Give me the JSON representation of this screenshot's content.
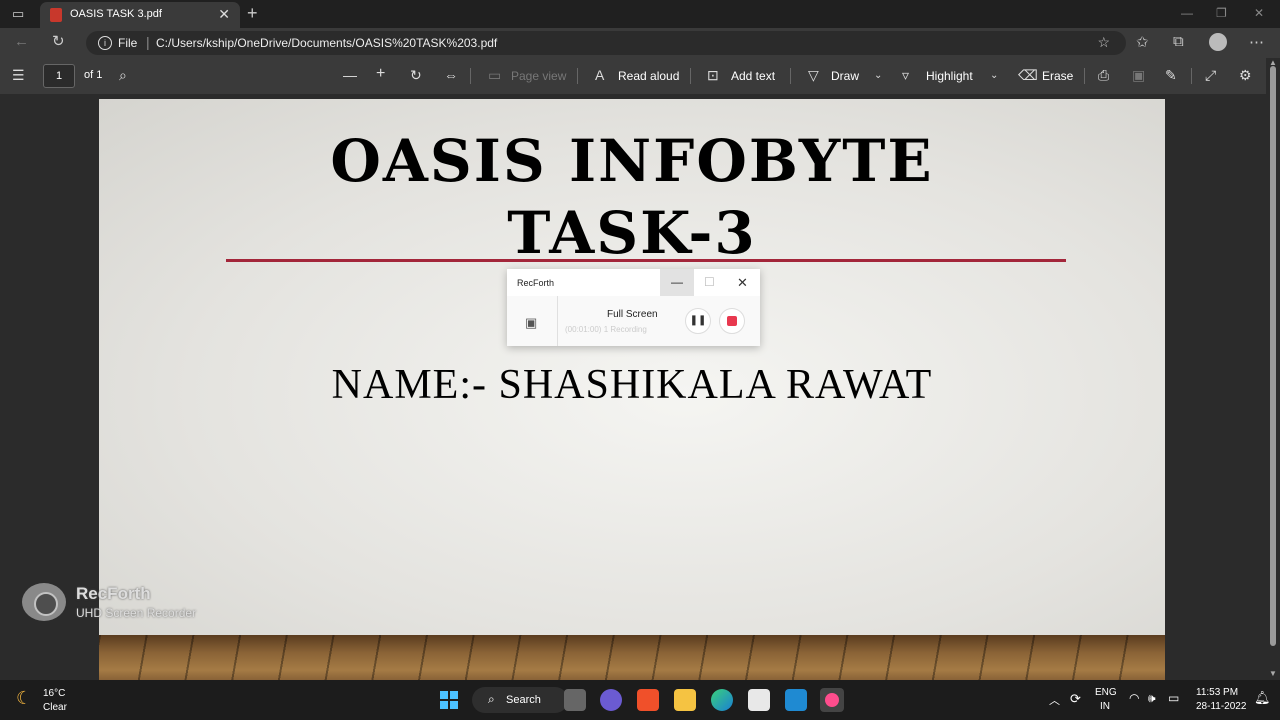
{
  "browser": {
    "tab_title": "OASIS TASK 3.pdf",
    "address": {
      "scheme_label": "File",
      "url": "C:/Users/kship/OneDrive/Documents/OASIS%20TASK%203.pdf"
    }
  },
  "pdf_toolbar": {
    "page_number": "1",
    "page_total": "of 1",
    "page_view": "Page view",
    "read_aloud": "Read aloud",
    "add_text": "Add text",
    "draw": "Draw",
    "highlight": "Highlight",
    "erase": "Erase"
  },
  "slide": {
    "title_line1": "OASIS INFOBYTE",
    "title_line2": "TASK-3",
    "name": "NAME:- SHASHIKALA RAWAT",
    "accent_line_color": "#a3263a"
  },
  "recorder_popup": {
    "app_name": "RecForth",
    "mode": "Full Screen",
    "faint_text": "(00:01:00) 1 Recording"
  },
  "watermark": {
    "brand": "RecForth",
    "subtitle": "UHD Screen Recorder"
  },
  "taskbar": {
    "weather_temp": "16°C",
    "weather_condition": "Clear",
    "search_label": "Search",
    "lang_line1": "ENG",
    "lang_line2": "IN",
    "time": "11:53 PM",
    "date": "28-11-2022"
  }
}
